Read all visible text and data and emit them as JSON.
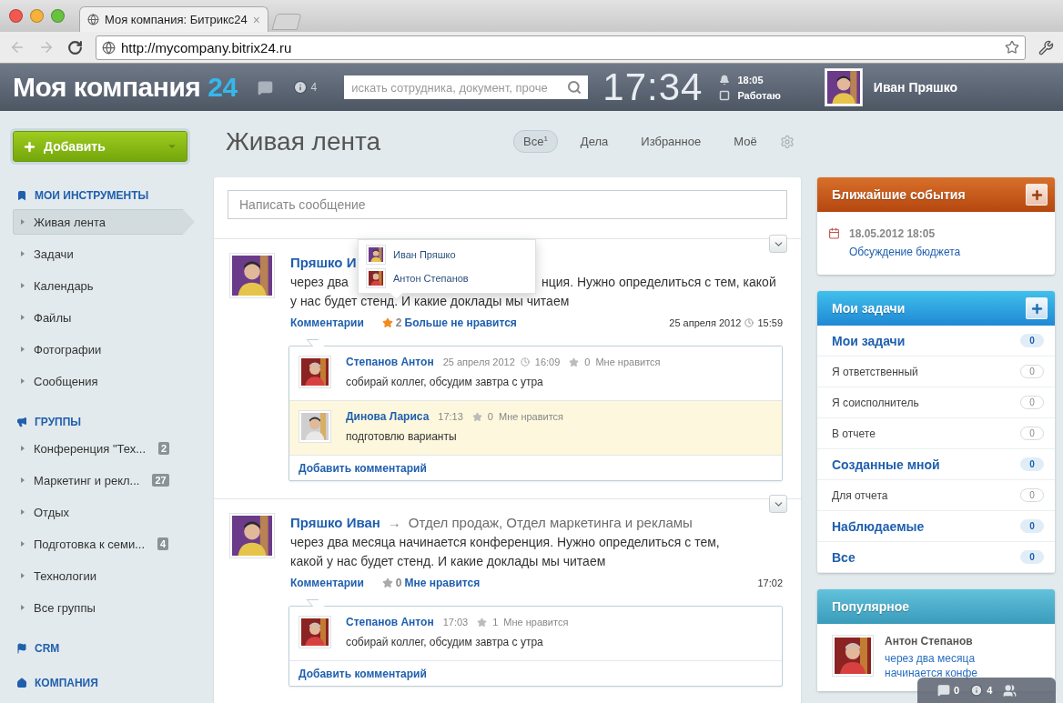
{
  "browser": {
    "tab_title": "Моя компания: Битрикс24",
    "tab_close": "×",
    "url": "http://mycompany.bitrix24.ru"
  },
  "header": {
    "logo": "Моя компания",
    "logo_number": "24",
    "notifications_count": "4",
    "search_placeholder": "искать сотрудника, документ, проче",
    "clock": "17:34",
    "alarm_time": "18:05",
    "work_status": "Работаю",
    "user_name": "Иван Пряшко"
  },
  "sidebar": {
    "add_button": "Добавить",
    "sections": [
      {
        "title": "МОИ ИНСТРУМЕНТЫ",
        "items": [
          {
            "label": "Живая лента",
            "selected": true
          },
          {
            "label": "Задачи",
            "selected": false
          },
          {
            "label": "Календарь",
            "selected": false
          },
          {
            "label": "Файлы",
            "selected": false
          },
          {
            "label": "Фотографии",
            "selected": false
          },
          {
            "label": "Сообщения",
            "selected": false
          }
        ]
      },
      {
        "title": "ГРУППЫ",
        "items": [
          {
            "label": "Конференция \"Тех...",
            "count": "2",
            "selected": false
          },
          {
            "label": "Маркетинг и рекл...",
            "count": "27",
            "selected": false
          },
          {
            "label": "Отдых",
            "selected": false
          },
          {
            "label": "Подготовка к семи...",
            "count": "4",
            "selected": false
          },
          {
            "label": "Технологии",
            "selected": false
          },
          {
            "label": "Все группы",
            "selected": false
          }
        ]
      },
      {
        "title": "CRM"
      },
      {
        "title": "КОМПАНИЯ"
      }
    ]
  },
  "feed": {
    "title": "Живая лента",
    "filters": [
      {
        "label": "Все",
        "count": "1",
        "selected": true
      },
      {
        "label": "Дела",
        "selected": false
      },
      {
        "label": "Избранное",
        "selected": false
      },
      {
        "label": "Моё",
        "selected": false
      }
    ],
    "composer_placeholder": "Написать сообщение",
    "posts": [
      {
        "author": "Пряшко И",
        "text_parts": [
          "через два",
          "нция. Нужно определиться с тем, какой",
          "у нас будет стенд. И какие доклады мы читаем"
        ],
        "comments_link": "Комментарии",
        "likes": "2",
        "liked": true,
        "like_action": "Больше не нравится",
        "date": "25 апреля 2012",
        "time": "15:59",
        "likers_popup": [
          {
            "name": "Иван Пряшко"
          },
          {
            "name": "Антон Степанов"
          }
        ],
        "comments": [
          {
            "author": "Степанов Антон",
            "date": "25 апреля 2012",
            "time": "16:09",
            "likes": "0",
            "like_action": "Мне нравится",
            "text": "собирай коллег, обсудим завтра с утра",
            "new": false
          },
          {
            "author": "Динова Лариса",
            "time": "17:13",
            "likes": "0",
            "like_action": "Мне нравится",
            "text": "подготовлю варианты",
            "new": true
          }
        ],
        "add_comment": "Добавить комментарий"
      },
      {
        "author": "Пряшко Иван",
        "arrow": "→",
        "recipients": "Отдел продаж, Отдел маркетинга и рекламы",
        "text": "через два месяца начинается конференция. Нужно определиться с тем, какой у нас будет стенд. И какие доклады мы читаем",
        "comments_link": "Комментарии",
        "likes": "0",
        "liked": false,
        "like_action": "Мне нравится",
        "time": "17:02",
        "comments": [
          {
            "author": "Степанов Антон",
            "time": "17:03",
            "likes": "1",
            "like_action": "Мне нравится",
            "text": "собирай коллег, обсудим завтра с утра",
            "new": false
          }
        ],
        "add_comment": "Добавить комментарий"
      }
    ]
  },
  "events": {
    "title": "Ближайшие события",
    "items": [
      {
        "datetime": "18.05.2012 18:05",
        "name": "Обсуждение бюджета"
      }
    ]
  },
  "tasks": {
    "title": "Мои задачи",
    "rows": [
      {
        "label": "Мои задачи",
        "count": "0",
        "kind": "group"
      },
      {
        "label": "Я ответственный",
        "count": "0",
        "kind": "item"
      },
      {
        "label": "Я соисполнитель",
        "count": "0",
        "kind": "item"
      },
      {
        "label": "В отчете",
        "count": "0",
        "kind": "item"
      },
      {
        "label": "Созданные мной",
        "count": "0",
        "kind": "group"
      },
      {
        "label": "Для отчета",
        "count": "0",
        "kind": "item"
      },
      {
        "label": "Наблюдаемые",
        "count": "0",
        "kind": "group"
      },
      {
        "label": "Все",
        "count": "0",
        "kind": "group"
      }
    ]
  },
  "popular": {
    "title": "Популярное",
    "items": [
      {
        "author": "Антон Степанов",
        "text": "через два месяца начинается конфе"
      }
    ]
  },
  "bottom_bar": {
    "messages": "0",
    "notifications": "4"
  }
}
